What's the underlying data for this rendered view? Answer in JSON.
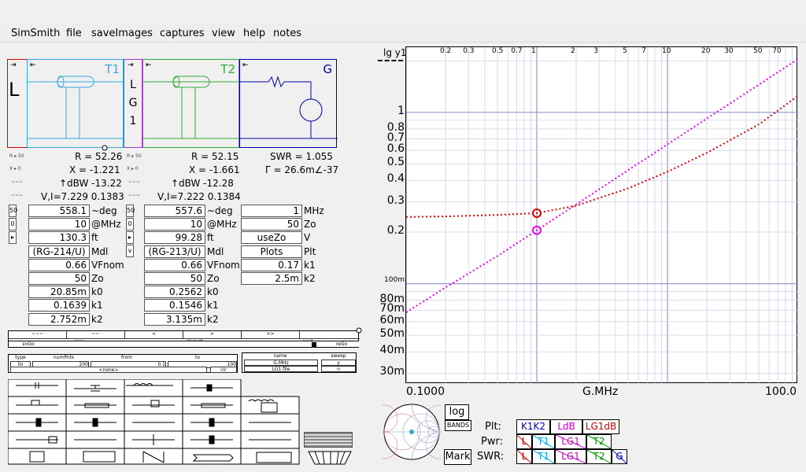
{
  "menu": [
    "SimSmith",
    "file",
    "saveImages",
    "captures",
    "view",
    "help",
    "notes"
  ],
  "schematic": {
    "load_label": "L",
    "t1_label": "T1",
    "t2_label": "T2",
    "g_label": "G",
    "mid_letters": [
      "L",
      "G",
      "1"
    ]
  },
  "readouts": {
    "col1": [
      "R = 52.26",
      "X = -1.221",
      "↑dBW -13.22",
      "V,I=7.229 0.1383"
    ],
    "col2": [
      "R = 52.15",
      "X = -1.661",
      "↑dBW -12.28",
      "V,I=7.222 0.1384"
    ],
    "col3": [
      "SWR = 1.055",
      "Γ = 26.6m∠-37"
    ],
    "side_icons": [
      "R ▸ 50",
      "X ▸ 0",
      "~~~",
      "~~~"
    ]
  },
  "t1_params": {
    "rows": [
      {
        "value": "558.1",
        "label": "~deg"
      },
      {
        "value": "10",
        "label": "@MHz"
      },
      {
        "value": "130.3",
        "label": "ft"
      },
      {
        "value": "(RG-214/U)",
        "label": "Mdl"
      },
      {
        "value": "0.66",
        "label": "VFnom"
      },
      {
        "value": "50",
        "label": "Zo"
      },
      {
        "value": "20.85m",
        "label": "k0"
      },
      {
        "value": "0.1639",
        "label": "k1"
      },
      {
        "value": "2.752m",
        "label": "k2"
      }
    ],
    "side_buttons": [
      "50",
      "0",
      "▸"
    ]
  },
  "t2_params": {
    "rows": [
      {
        "value": "557.6",
        "label": "~deg"
      },
      {
        "value": "10",
        "label": "@MHz"
      },
      {
        "value": "99.28",
        "label": "ft"
      },
      {
        "value": "(RG-213/U)",
        "label": "Mdl"
      },
      {
        "value": "0.66",
        "label": "VFnom"
      },
      {
        "value": "50",
        "label": "Zo"
      },
      {
        "value": "0.2562",
        "label": "k0"
      },
      {
        "value": "0.1546",
        "label": "k1"
      },
      {
        "value": "3.135m",
        "label": "k2"
      }
    ],
    "side_buttons": [
      "50",
      "0",
      "▸",
      "v"
    ]
  },
  "g_params": {
    "rows": [
      {
        "value": "1",
        "label": "MHz"
      },
      {
        "value": "50",
        "label": "Zo"
      },
      {
        "value": "useZo",
        "label": "V"
      },
      {
        "value": "Plots",
        "label": "Plt"
      },
      {
        "value": "0.17",
        "label": "k1"
      },
      {
        "value": "2.5m",
        "label": "k2"
      }
    ]
  },
  "sweep_panel": {
    "slider_labels": [
      "~~~",
      "~~",
      "<",
      "closest",
      ">",
      ">>",
      "next"
    ],
    "sub_labels": [
      "snGo",
      "prev",
      "reGo"
    ],
    "headers": [
      "type",
      "numPnts",
      "from",
      "to",
      "name",
      "sweep"
    ],
    "values": [
      "lin",
      "200",
      "0.1",
      "100",
      "G.MHz",
      "y"
    ],
    "extra": [
      "<none>",
      "clr",
      "LG1.file",
      "n"
    ]
  },
  "plot": {
    "y_title": "lg y1",
    "y_labels": [
      "1",
      "0.8",
      "0.7",
      "0.6",
      "0.5",
      "0.4",
      "0.3",
      "0.2",
      "100m",
      "80m",
      "70m",
      "60m",
      "50m",
      "40m",
      "30m"
    ],
    "top_labels": [
      "0.2",
      "0.3",
      "0.5",
      "0.7",
      "1",
      "2",
      "3",
      "5",
      "7",
      "10",
      "20",
      "30",
      "50",
      "70"
    ],
    "x_labels": [
      "0.1000",
      "G.MHz",
      "100.0"
    ],
    "xlim": [
      0.1,
      100
    ],
    "ylim_log": [
      0.026,
      2.4
    ],
    "series_red_color": "#dd0000",
    "series_magenta_color": "#ee00ee"
  },
  "chart_data": {
    "type": "line",
    "xlabel": "G.MHz",
    "ylabel": "lg y1",
    "x_scale": "log",
    "y_scale": "log",
    "xlim": [
      0.1,
      100
    ],
    "ylim": [
      0.026,
      2.4
    ],
    "series": [
      {
        "color": "#dd0000",
        "x": [
          0.1,
          0.2,
          0.5,
          1,
          2,
          5,
          10,
          20,
          50,
          100
        ],
        "y": [
          0.245,
          0.247,
          0.252,
          0.258,
          0.285,
          0.36,
          0.45,
          0.58,
          0.85,
          1.25
        ]
      },
      {
        "color": "#ee00ee",
        "x": [
          0.1,
          0.2,
          0.5,
          1,
          2,
          5,
          10,
          20,
          50,
          100
        ],
        "y": [
          0.068,
          0.095,
          0.145,
          0.205,
          0.29,
          0.46,
          0.65,
          0.92,
          1.45,
          2.05
        ]
      }
    ],
    "markers": [
      {
        "color": "#dd0000",
        "x": 1,
        "y": 0.258
      },
      {
        "color": "#ee00ee",
        "x": 1,
        "y": 0.205
      }
    ]
  },
  "bottom_right": {
    "log_btn": "log",
    "bands_btn": "BANDS",
    "mark_btn": "Mark",
    "plt_label": "Plt:",
    "pwr_label": "Pwr:",
    "swr_label": "SWR:",
    "plt_items": [
      {
        "text": "K1K2",
        "color": "#0000cc"
      },
      {
        "text": "LdB",
        "color": "#cc00cc"
      },
      {
        "text": "LG1dB",
        "color": "#cc0000"
      }
    ],
    "pwr_items": [
      {
        "text": "L",
        "color": "#cc0000"
      },
      {
        "text": "T1",
        "color": "#00aaee"
      },
      {
        "text": "LG1",
        "color": "#cc00cc"
      },
      {
        "text": "T2",
        "color": "#009900"
      }
    ],
    "swr_items": [
      {
        "text": "L",
        "color": "#cc0000"
      },
      {
        "text": "T1",
        "color": "#00aaee"
      },
      {
        "text": "LG1",
        "color": "#cc00cc"
      },
      {
        "text": "T2",
        "color": "#009900"
      },
      {
        "text": "G",
        "color": "#0000cc"
      }
    ]
  },
  "colors": {
    "load": "#cc0000",
    "t1": "#33aadd",
    "mid": "#aa33cc",
    "t2": "#33aa33",
    "gen": "#0000aa"
  }
}
